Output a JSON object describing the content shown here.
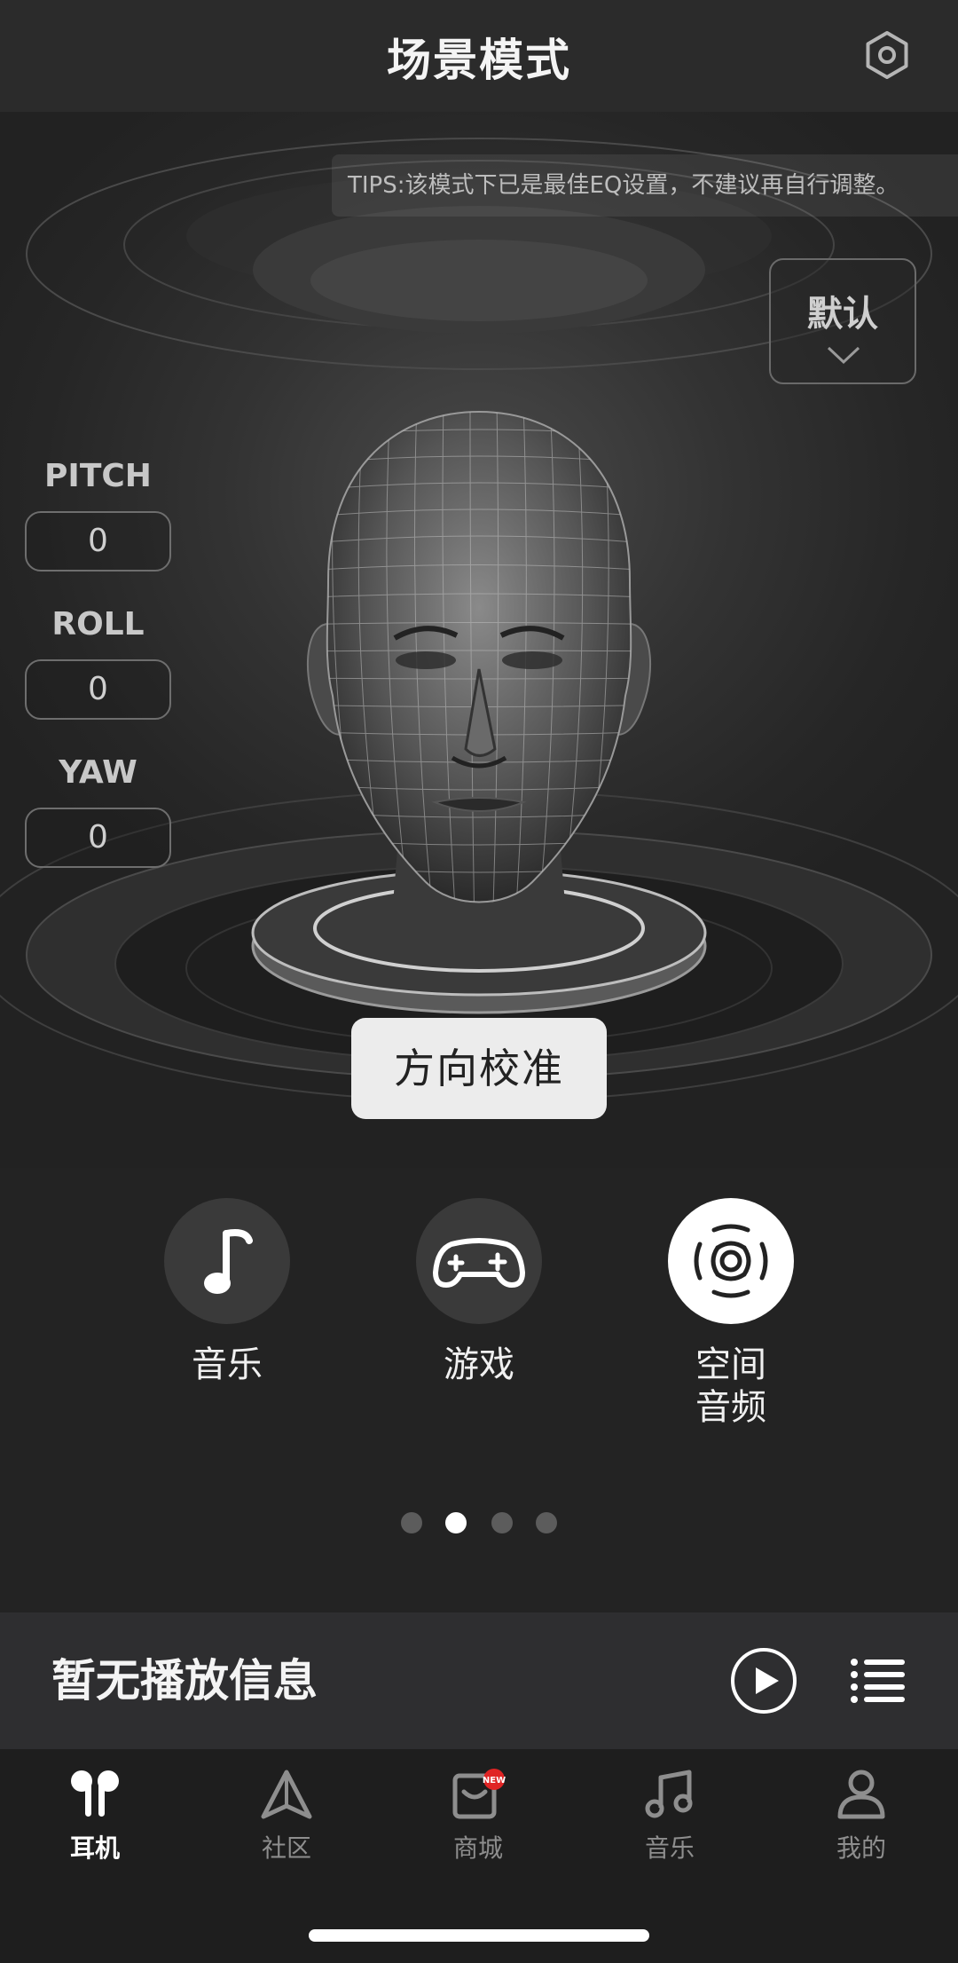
{
  "header": {
    "title": "场景模式",
    "settings_icon": "settings-gear-icon"
  },
  "tips": "TIPS:该模式下已是最佳EQ设置，不建议再自行调整。",
  "preset": {
    "label": "默认"
  },
  "orientation": {
    "pitch": {
      "label": "PITCH",
      "value": "0"
    },
    "roll": {
      "label": "ROLL",
      "value": "0"
    },
    "yaw": {
      "label": "YAW",
      "value": "0"
    }
  },
  "calibrate_label": "方向校准",
  "modes": [
    {
      "label": "音乐",
      "icon": "music-note-icon",
      "active": false
    },
    {
      "label": "游戏",
      "icon": "gamepad-icon",
      "active": false
    },
    {
      "label": "空间\n音频",
      "line1": "空间",
      "line2": "音频",
      "icon": "spatial-audio-icon",
      "active": true
    }
  ],
  "page_dots": {
    "count": 4,
    "active_index": 1
  },
  "player": {
    "title": "暂无播放信息"
  },
  "tabs": [
    {
      "label": "耳机",
      "icon": "earbuds-icon",
      "active": true
    },
    {
      "label": "社区",
      "icon": "triangle-icon",
      "active": false
    },
    {
      "label": "商城",
      "icon": "shop-icon",
      "active": false,
      "badge": "NEW"
    },
    {
      "label": "音乐",
      "icon": "music-icon",
      "active": false
    },
    {
      "label": "我的",
      "icon": "profile-icon",
      "active": false
    }
  ],
  "colors": {
    "background": "#232323",
    "header": "#2b2b2b",
    "player": "#2e2e30",
    "tabbar": "#1e1e1e",
    "badge": "#e02424"
  }
}
